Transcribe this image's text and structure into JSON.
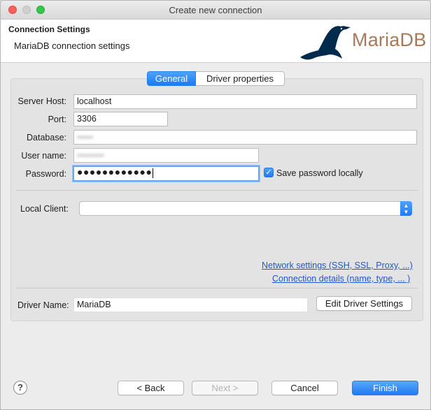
{
  "window": {
    "title": "Create new connection"
  },
  "banner": {
    "title": "Connection Settings",
    "subtitle": "MariaDB connection settings",
    "logo_text": "MariaDB"
  },
  "tabs": [
    {
      "label": "General",
      "active": true
    },
    {
      "label": "Driver properties",
      "active": false
    }
  ],
  "form": {
    "server_host_label": "Server Host:",
    "server_host_value": "localhost",
    "port_label": "Port:",
    "port_value": "3306",
    "database_label": "Database:",
    "database_value": "••••••",
    "username_label": "User name:",
    "username_value": "••••••••••",
    "password_label": "Password:",
    "password_value": "●●●●●●●●●●●●",
    "save_password_label": "Save password locally",
    "save_password_checked": true,
    "local_client_label": "Local Client:",
    "local_client_value": ""
  },
  "links": {
    "network": "Network settings (SSH, SSL, Proxy, ...)",
    "connection_details": "Connection details (name, type, ... )"
  },
  "driver": {
    "label": "Driver Name:",
    "value": "MariaDB",
    "edit_button": "Edit Driver Settings"
  },
  "footer": {
    "help": "?",
    "back": "< Back",
    "next": "Next >",
    "cancel": "Cancel",
    "finish": "Finish"
  },
  "colors": {
    "accent": "#1f7af4",
    "link": "#2158c7",
    "logo": "#a57a5a",
    "logo_seal": "#002b4d"
  }
}
